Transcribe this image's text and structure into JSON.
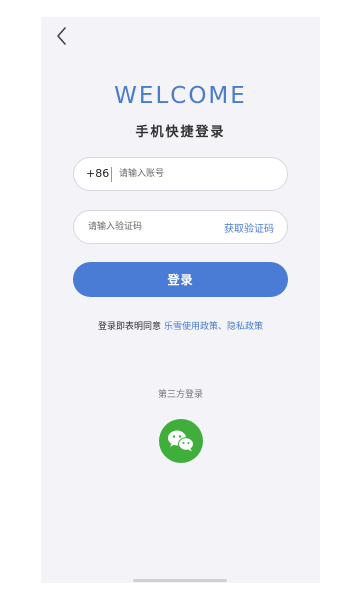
{
  "colors": {
    "accent": "#4a7cc9",
    "button": "#4a7cd6",
    "wechat": "#3fae3b",
    "background": "#f3f3f8"
  },
  "header": {
    "back_icon": "chevron-left-icon",
    "welcome": "WELCOME",
    "subtitle": "手机快捷登录"
  },
  "form": {
    "phone_prefix": "+86",
    "phone_placeholder": "请输入账号",
    "phone_value": "",
    "code_placeholder": "请输入验证码",
    "code_value": "",
    "get_code_label": "获取验证码",
    "login_label": "登录"
  },
  "agreement": {
    "prefix": "登录即表明同意",
    "link": "乐雪使用政策、隐私政策"
  },
  "third_party": {
    "label": "第三方登录",
    "wechat_icon": "wechat-icon"
  }
}
